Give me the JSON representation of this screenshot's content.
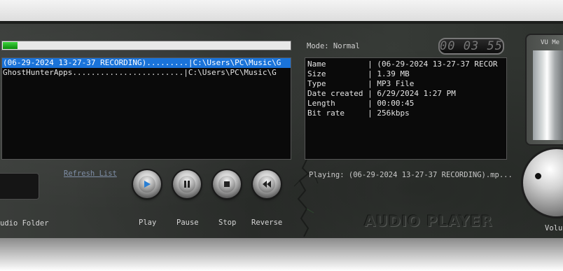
{
  "progress": {
    "fraction": 0.05,
    "color": "#22b022"
  },
  "playlist": {
    "items": [
      {
        "text": "(06-29-2024 13-27-37 RECORDING).........|C:\\Users\\PC\\Music\\G",
        "selected": true
      },
      {
        "text": "GhostHunterApps........................|C:\\Users\\PC\\Music\\G",
        "selected": false
      }
    ]
  },
  "refresh_label": "Refresh List",
  "folder_label": "udio Folder",
  "controls": {
    "play": {
      "label": "Play",
      "icon": "play-icon"
    },
    "pause": {
      "label": "Pause",
      "icon": "pause-icon"
    },
    "stop": {
      "label": "Stop",
      "icon": "stop-icon"
    },
    "reverse": {
      "label": "Reverse",
      "icon": "rewind-icon"
    }
  },
  "mode": "Mode: Normal",
  "clock": "00 03 55",
  "info": [
    "Name         | (06-29-2024 13-27-37 RECOR",
    "Size         | 1.39 MB",
    "Type         | MP3 File",
    "Date created | 6/29/2024 1:27 PM",
    "Length       | 00:00:45",
    "Bit rate     | 256kbps"
  ],
  "playing": "Playing: (06-29-2024 13-27-37 RECORDING).mp...",
  "logo": "AUDIO PLAYER",
  "vu_label": "VU Me",
  "volume_label": "Volu",
  "colors": {
    "selection": "#1a73d9",
    "panel": "#333633"
  }
}
